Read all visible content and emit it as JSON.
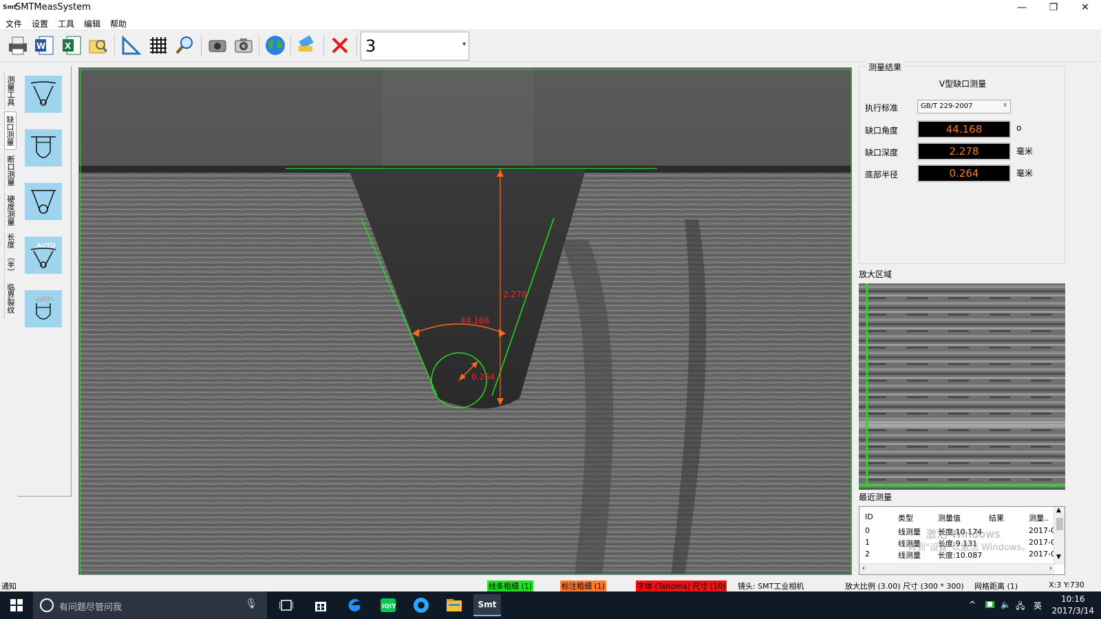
{
  "window": {
    "app_icon": "Smt",
    "title": "SMTMeasSystem",
    "minimize": "—",
    "restore": "❐",
    "close": "✕"
  },
  "menu": [
    "文件",
    "设置",
    "工具",
    "编辑",
    "帮助"
  ],
  "toolbar": {
    "icons": [
      "print-icon",
      "word-icon",
      "excel-icon",
      "open-image-icon",
      "ruler-icon",
      "grid-icon",
      "magnifier-icon",
      "camera-icon",
      "snapshot-icon",
      "globe-icon",
      "clear-icon",
      "delete-icon"
    ],
    "combo_value": "3"
  },
  "left_tabs": [
    "测量工具",
    "缺口测量",
    "断口测量",
    "硬度测量",
    "长度",
    "（半）",
    "临界裂纹"
  ],
  "tool_buttons": [
    "v-notch-tool-icon",
    "u-notch-tool-icon",
    "v-notch-circle-tool-icon",
    "auto-v-notch-tool-icon",
    "auto-u-notch-tool-icon"
  ],
  "image_annotations": {
    "depth": "2.278",
    "angle": "44.168",
    "radius": "0.264"
  },
  "results": {
    "group_title": "测量结果",
    "measurement_type": "V型缺口测量",
    "standard_label": "执行标准",
    "standard_value": "GB/T 229-2007",
    "rows": [
      {
        "label": "缺口角度",
        "value": "44.168",
        "unit": "o"
      },
      {
        "label": "缺口深度",
        "value": "2.278",
        "unit": "毫米"
      },
      {
        "label": "底部半径",
        "value": "0.264",
        "unit": "毫米"
      }
    ],
    "value_color": "#ff7a1a"
  },
  "zoom": {
    "label": "放大区域"
  },
  "recent": {
    "label": "最近测量",
    "columns": [
      "ID",
      "类型",
      "测量值",
      "结果",
      "测量.."
    ],
    "rows": [
      [
        "0",
        "线测量",
        "长度:10.174",
        "",
        "2017-0"
      ],
      [
        "1",
        "线测量",
        "长度:9.131",
        "",
        "2017-0"
      ],
      [
        "2",
        "线测量",
        "长度:10.087",
        "",
        "2017-0"
      ]
    ],
    "watermark_1": "激活 Windows",
    "watermark_2": "转到\"设置\"以激活 Windows。"
  },
  "status": {
    "notice": "通知",
    "line_width": "线条粗细 (1)",
    "label_width": "标注粗细 (1)",
    "font": "字体 (Tahoma) 尺寸 (10)",
    "lens": "镜头: SMT工业相机",
    "scale": "放大比例 (3.00) 尺寸 (300 * 300)",
    "grid": "网格距离 (1)",
    "coords": "X:3 Y:730"
  },
  "taskbar": {
    "search_placeholder": "有问题尽管问我",
    "time": "10:16",
    "date": "2017/3/14",
    "ime": "英"
  },
  "colors": {
    "overlay_green": "#22dd22",
    "overlay_orange": "#ff6a1a",
    "annotation_red": "#ff2020"
  }
}
